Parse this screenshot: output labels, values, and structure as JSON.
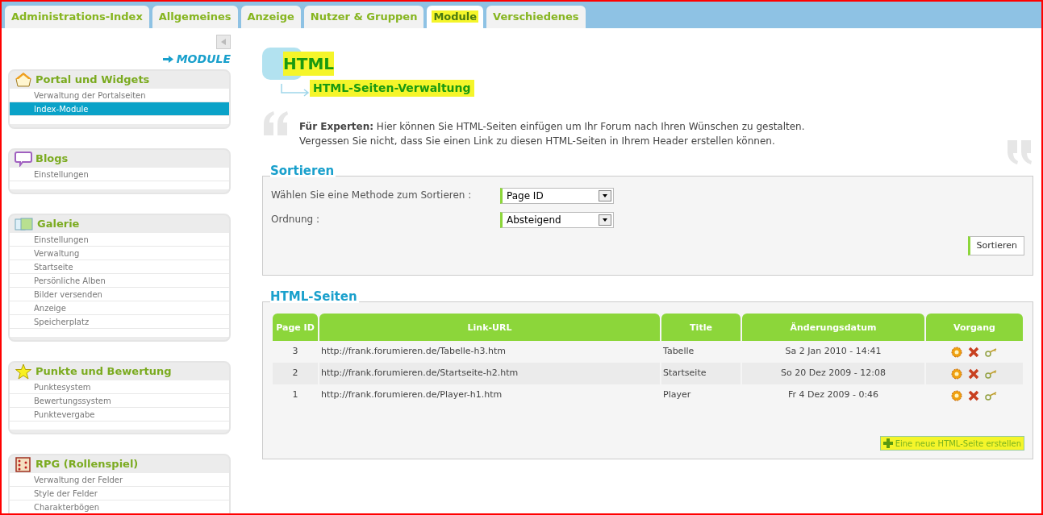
{
  "tabs": [
    {
      "label": "Administrations-Index",
      "selected": false,
      "highlighted": false
    },
    {
      "label": "Allgemeines",
      "selected": false,
      "highlighted": false
    },
    {
      "label": "Anzeige",
      "selected": false,
      "highlighted": false
    },
    {
      "label": "Nutzer & Gruppen",
      "selected": false,
      "highlighted": false
    },
    {
      "label": "Module",
      "selected": true,
      "highlighted": true
    },
    {
      "label": "Verschiedenes",
      "selected": false,
      "highlighted": false
    }
  ],
  "sidebar": {
    "section_title": "MODULE",
    "groups": [
      {
        "title": "Portal und Widgets",
        "items": [
          {
            "label": "Verwaltung der Portalseiten",
            "selected": false
          },
          {
            "label": "Index-Module",
            "selected": true
          }
        ]
      },
      {
        "title": "Blogs",
        "items": [
          {
            "label": "Einstellungen",
            "selected": false
          }
        ]
      },
      {
        "title": "Galerie",
        "items": [
          {
            "label": "Einstellungen",
            "selected": false
          },
          {
            "label": "Verwaltung",
            "selected": false
          },
          {
            "label": "Startseite",
            "selected": false
          },
          {
            "label": "Persönliche Alben",
            "selected": false
          },
          {
            "label": "Bilder versenden",
            "selected": false
          },
          {
            "label": "Anzeige",
            "selected": false
          },
          {
            "label": "Speicherplatz",
            "selected": false
          }
        ]
      },
      {
        "title": "Punkte und Bewertung",
        "items": [
          {
            "label": "Punktesystem",
            "selected": false
          },
          {
            "label": "Bewertungssystem",
            "selected": false
          },
          {
            "label": "Punktevergabe",
            "selected": false
          }
        ]
      },
      {
        "title": "RPG (Rollenspiel)",
        "items": [
          {
            "label": "Verwaltung der Felder",
            "selected": false
          },
          {
            "label": "Style der Felder",
            "selected": false
          },
          {
            "label": "Charakterbögen",
            "selected": false
          }
        ]
      }
    ]
  },
  "page": {
    "title": "HTML",
    "title_highlighted": true,
    "subtitle": "HTML-Seiten-Verwaltung",
    "subtitle_highlighted": true,
    "intro": [
      "**Für Experten:** Hier können Sie HTML-Seiten einfügen um Ihr Forum nach Ihren Wünschen zu gestalten.",
      "Vergessen Sie nicht, dass Sie einen Link zu diesen HTML-Seiten in Ihrem Header erstellen können."
    ]
  },
  "sort": {
    "legend": "Sortieren",
    "fields": [
      {
        "label": "Wählen Sie eine Methode zum Sortieren :",
        "value": "Page ID"
      },
      {
        "label": "Ordnung :",
        "value": "Absteigend"
      }
    ],
    "button": "Sortieren"
  },
  "pages": {
    "legend": "HTML-Seiten",
    "columns": [
      "Page ID",
      "Link-URL",
      "Title",
      "Änderungsdatum",
      "Vorgang"
    ],
    "rows": [
      {
        "id": "3",
        "url": "http://frank.forumieren.de/Tabelle-h3.htm",
        "title": "Tabelle",
        "date": "Sa 2 Jan 2010 - 14:41"
      },
      {
        "id": "2",
        "url": "http://frank.forumieren.de/Startseite-h2.htm",
        "title": "Startseite",
        "date": "So 20 Dez 2009 - 12:08"
      },
      {
        "id": "1",
        "url": "http://frank.forumieren.de/Player-h1.htm",
        "title": "Player",
        "date": "Fr 4 Dez 2009 - 0:46"
      }
    ],
    "create_button": "Eine neue HTML-Seite erstellen",
    "create_highlighted": true
  }
}
